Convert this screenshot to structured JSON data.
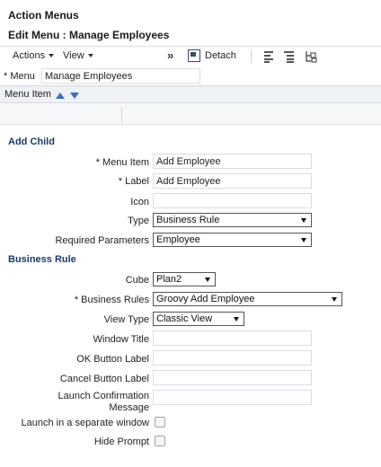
{
  "header": {
    "app_title": "Action Menus",
    "page_title": "Edit Menu : Manage Employees"
  },
  "toolbar": {
    "actions_label": "Actions",
    "view_label": "View",
    "overflow_label": "»",
    "detach_label": "Detach",
    "icons": [
      "align-left-icon",
      "align-top-icon",
      "tree-move-icon"
    ]
  },
  "menu": {
    "label": "* Menu",
    "value": "Manage Employees"
  },
  "grid": {
    "column_header": "Menu Item"
  },
  "add_child": {
    "section_title": "Add Child",
    "menu_item_label": "* Menu Item",
    "menu_item_value": "Add Employee",
    "label_label": "* Label",
    "label_value": "Add Employee",
    "icon_label": "Icon",
    "icon_value": "",
    "type_label": "Type",
    "type_value": "Business Rule",
    "required_params_label": "Required Parameters",
    "required_params_value": "Employee"
  },
  "business_rule": {
    "section_title": "Business Rule",
    "cube_label": "Cube",
    "cube_value": "Plan2",
    "rules_label": "* Business Rules",
    "rules_value": "Groovy Add Employee",
    "view_type_label": "View Type",
    "view_type_value": "Classic View",
    "window_title_label": "Window Title",
    "window_title_value": "",
    "ok_button_label": "OK Button Label",
    "ok_button_value": "",
    "cancel_button_label": "Cancel Button Label",
    "cancel_button_value": "",
    "launch_confirm_label_1": "Launch Confirmation",
    "launch_confirm_label_2": "Message",
    "launch_confirm_value": "",
    "separate_window_label": "Launch in a separate window",
    "hide_prompt_label": "Hide Prompt"
  }
}
